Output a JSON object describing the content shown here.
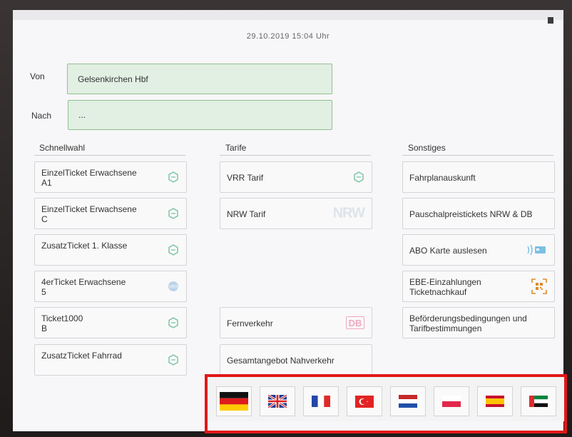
{
  "header": {
    "datetime": "29.10.2019  15:04  Uhr"
  },
  "route": {
    "from_label": "Von",
    "from_value": "Gelsenkirchen Hbf",
    "to_label": "Nach",
    "to_value": "..."
  },
  "columns": {
    "schnellwahl": {
      "title": "Schnellwahl",
      "items": [
        {
          "label": "EinzelTicket Erwachsene\nA1"
        },
        {
          "label": "EinzelTicket Erwachsene\nC"
        },
        {
          "label": "ZusatzTicket 1. Klasse"
        },
        {
          "label": "4erTicket Erwachsene\n5"
        },
        {
          "label": "Ticket1000\nB"
        },
        {
          "label": "ZusatzTicket Fahrrad"
        }
      ]
    },
    "tarife": {
      "title": "Tarife",
      "items": [
        {
          "label": "VRR Tarif"
        },
        {
          "label": "NRW Tarif",
          "logo": "NRW"
        },
        {
          "label": "Fernverkehr",
          "logo": "DB"
        },
        {
          "label": "Gesamtangebot Nahverkehr"
        }
      ]
    },
    "sonstiges": {
      "title": "Sonstiges",
      "items": [
        {
          "label": "Fahrplanauskunft"
        },
        {
          "label": "Pauschalpreistickets NRW & DB"
        },
        {
          "label": "ABO Karte auslesen"
        },
        {
          "label": "EBE-Einzahlungen\nTicketnachkauf"
        },
        {
          "label": "Beförderungsbedingungen und\nTarifbestimmungen"
        }
      ]
    }
  },
  "languages": [
    "german-flag-icon",
    "uk-flag-icon",
    "french-flag-icon",
    "turkish-flag-icon",
    "dutch-flag-icon",
    "polish-flag-icon",
    "spanish-flag-icon",
    "arabic-flag-icon"
  ],
  "colors": {
    "accent_green": "#8fc18e",
    "highlight_red": "#e01818",
    "field_bg": "#e2efe3"
  }
}
